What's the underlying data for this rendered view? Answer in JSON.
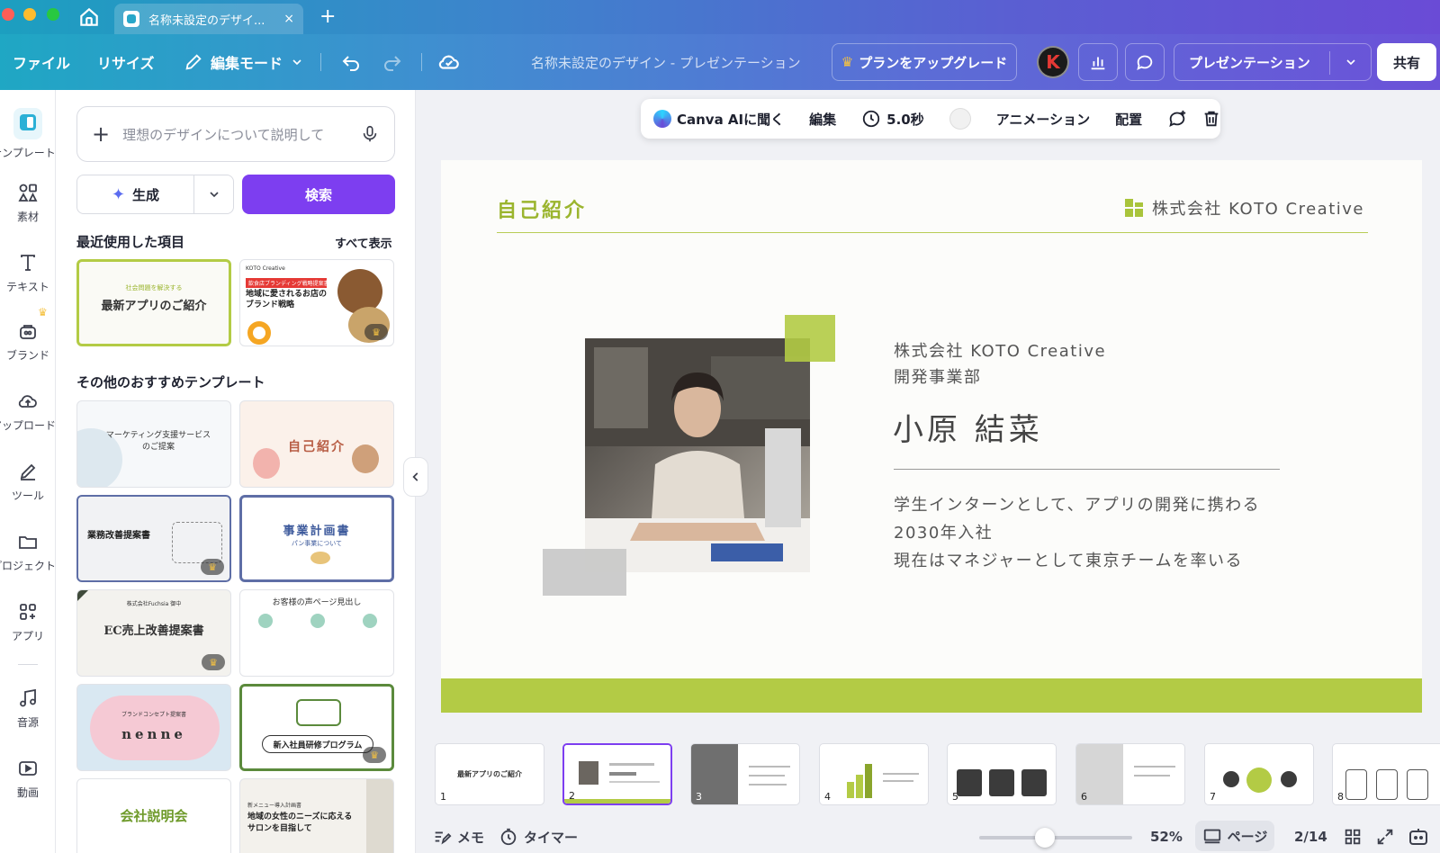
{
  "window": {
    "tab_title": "名称未設定のデザイ...",
    "close_glyph": "×",
    "newtab_glyph": "+"
  },
  "toolbar": {
    "file": "ファイル",
    "resize": "リサイズ",
    "edit_mode": "編集モード",
    "doc_title": "名称未設定のデザイン - プレゼンテーション",
    "upgrade": "プランをアップグレード",
    "avatar_letter": "K",
    "present": "プレゼンテーション",
    "share": "共有"
  },
  "rail": {
    "items": [
      {
        "label": "テンプレート",
        "icon": "template-icon"
      },
      {
        "label": "素材",
        "icon": "elements-icon"
      },
      {
        "label": "テキスト",
        "icon": "text-icon"
      },
      {
        "label": "ブランド",
        "icon": "brand-icon"
      },
      {
        "label": "アップロード",
        "icon": "upload-icon"
      },
      {
        "label": "ツール",
        "icon": "tools-icon"
      },
      {
        "label": "プロジェクト",
        "icon": "folder-icon"
      },
      {
        "label": "アプリ",
        "icon": "apps-icon"
      },
      {
        "label": "音源",
        "icon": "music-icon"
      },
      {
        "label": "動画",
        "icon": "video-icon"
      }
    ]
  },
  "panel": {
    "prompt_placeholder": "理想のデザインについて説明して",
    "generate": "生成",
    "search": "検索",
    "recent_heading": "最近使用した項目",
    "see_all": "すべて表示",
    "recent": [
      {
        "subtitle": "社会問題を解決する",
        "title": "最新アプリのご紹介"
      },
      {
        "small": "KOTO Creative",
        "badge": "飲食店ブランディング戦略提案書",
        "title": "地域に愛されるお店のブランド戦略"
      }
    ],
    "recommended_heading": "その他のおすすめテンプレート",
    "recommended": [
      {
        "title": "マーケティング支援サービスのご提案"
      },
      {
        "title": "自己紹介"
      },
      {
        "title": "業務改善提案書"
      },
      {
        "title": "事業計画書",
        "subtitle": "パン事業について"
      },
      {
        "title": "EC売上改善提案書",
        "small": "株式会社Fuchsia 御中"
      },
      {
        "title": "お客様の声ページ見出し"
      },
      {
        "title": "nenne",
        "small": "ブランドコンセプト提案書"
      },
      {
        "title": "新入社員研修プログラム"
      },
      {
        "title": "会社説明会"
      },
      {
        "small": "新メニュー導入計画書",
        "title": "地域の女性のニーズに応えるサロンを目指して"
      }
    ]
  },
  "floating_toolbar": {
    "ask_ai": "Canva AIに聞く",
    "edit": "編集",
    "duration": "5.0秒",
    "animation": "アニメーション",
    "arrange": "配置"
  },
  "slide": {
    "heading": "自己紹介",
    "company": "株式会社 KOTO Creative",
    "org_line1": "株式会社 KOTO Creative",
    "org_line2": "開発事業部",
    "name": "小原 結菜",
    "desc_line1": "学生インターンとして、アプリの開発に携わる",
    "desc_line2": "2030年入社",
    "desc_line3": "現在はマネジャーとして東京チームを率いる",
    "accent_color": "#b3cb45"
  },
  "filmstrip": {
    "pages": [
      "1",
      "2",
      "3",
      "4",
      "5",
      "6",
      "7",
      "8"
    ],
    "thumb1_title": "最新アプリのご紹介",
    "selected": 2
  },
  "bottom_bar": {
    "notes": "メモ",
    "timer": "タイマー",
    "zoom": "52%",
    "zoom_fraction": 0.52,
    "page_view": "ページ",
    "page_count": "2/14"
  }
}
